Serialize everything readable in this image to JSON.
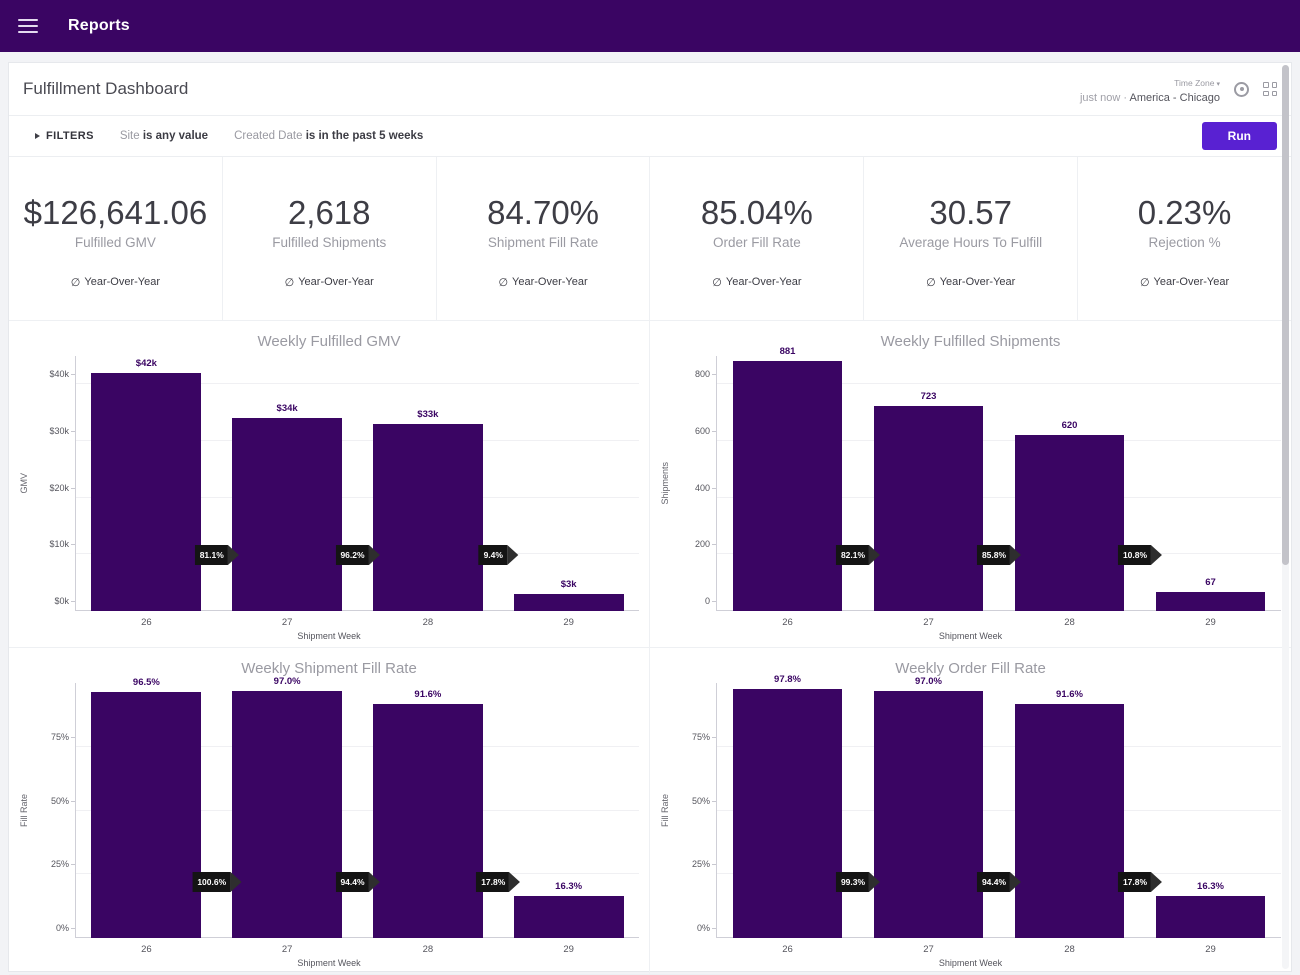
{
  "appbar": {
    "title": "Reports",
    "menu_icon": "hamburger-icon"
  },
  "dashboard": {
    "title": "Fulfillment Dashboard",
    "updated": "just now",
    "separator": "·",
    "timezone_label": "Time Zone",
    "timezone_value": "America - Chicago",
    "gear_icon": "gear-icon",
    "grid_icon": "grid-icon"
  },
  "filters": {
    "toggle_label": "FILTERS",
    "items": [
      {
        "field": "Site",
        "condition": "is any value"
      },
      {
        "field": "Created Date",
        "condition": "is in the past 5 weeks"
      }
    ],
    "run_label": "Run"
  },
  "kpis": [
    {
      "value": "$126,641.06",
      "label": "Fulfilled GMV",
      "delta": "Year-Over-Year",
      "delta_icon": "null-icon"
    },
    {
      "value": "2,618",
      "label": "Fulfilled Shipments",
      "delta": "Year-Over-Year",
      "delta_icon": "null-icon"
    },
    {
      "value": "84.70%",
      "label": "Shipment Fill Rate",
      "delta": "Year-Over-Year",
      "delta_icon": "null-icon"
    },
    {
      "value": "85.04%",
      "label": "Order Fill Rate",
      "delta": "Year-Over-Year",
      "delta_icon": "null-icon"
    },
    {
      "value": "30.57",
      "label": "Average Hours To Fulfill",
      "delta": "Year-Over-Year",
      "delta_icon": "null-icon"
    },
    {
      "value": "0.23%",
      "label": "Rejection %",
      "delta": "Year-Over-Year",
      "delta_icon": "null-icon"
    }
  ],
  "colors": {
    "brand_purple": "#3a0563",
    "run_button": "#5921d2",
    "bar_fill": "#3a0563",
    "delta_pill": "#141414"
  },
  "chart_data": [
    {
      "type": "bar",
      "title": "Weekly Fulfilled GMV",
      "xlabel": "Shipment Week",
      "ylabel": "GMV",
      "categories": [
        "26",
        "27",
        "28",
        "29"
      ],
      "values": [
        42000,
        34000,
        33000,
        3000
      ],
      "value_labels": [
        "$42k",
        "$34k",
        "$33k",
        "$3k"
      ],
      "ylim": [
        0,
        45000
      ],
      "yticks": [
        0,
        10000,
        20000,
        30000,
        40000
      ],
      "ytick_labels": [
        "$0k",
        "$10k",
        "$20k",
        "$30k",
        "$40k"
      ],
      "grid": true,
      "legend": "none",
      "annotations": [
        {
          "label": "81.1%",
          "between": [
            "26",
            "27"
          ]
        },
        {
          "label": "96.2%",
          "between": [
            "27",
            "28"
          ]
        },
        {
          "label": "9.4%",
          "between": [
            "28",
            "29"
          ]
        }
      ]
    },
    {
      "type": "bar",
      "title": "Weekly Fulfilled Shipments",
      "xlabel": "Shipment Week",
      "ylabel": "Shipments",
      "categories": [
        "26",
        "27",
        "28",
        "29"
      ],
      "values": [
        881,
        723,
        620,
        67
      ],
      "value_labels": [
        "881",
        "723",
        "620",
        "67"
      ],
      "ylim": [
        0,
        900
      ],
      "yticks": [
        0,
        200,
        400,
        600,
        800
      ],
      "ytick_labels": [
        "0",
        "200",
        "400",
        "600",
        "800"
      ],
      "grid": true,
      "legend": "none",
      "annotations": [
        {
          "label": "82.1%",
          "between": [
            "26",
            "27"
          ]
        },
        {
          "label": "85.8%",
          "between": [
            "27",
            "28"
          ]
        },
        {
          "label": "10.8%",
          "between": [
            "28",
            "29"
          ]
        }
      ]
    },
    {
      "type": "bar",
      "title": "Weekly Shipment Fill Rate",
      "xlabel": "Shipment Week",
      "ylabel": "Fill Rate",
      "categories": [
        "26",
        "27",
        "28",
        "29"
      ],
      "values": [
        96.5,
        97.0,
        91.6,
        16.3
      ],
      "value_labels": [
        "96.5%",
        "97.0%",
        "91.6%",
        "16.3%"
      ],
      "ylim": [
        0,
        100
      ],
      "yticks": [
        0,
        25,
        50,
        75
      ],
      "ytick_labels": [
        "0%",
        "25%",
        "50%",
        "75%"
      ],
      "grid": true,
      "legend": "none",
      "annotations": [
        {
          "label": "100.6%",
          "between": [
            "26",
            "27"
          ]
        },
        {
          "label": "94.4%",
          "between": [
            "27",
            "28"
          ]
        },
        {
          "label": "17.8%",
          "between": [
            "28",
            "29"
          ]
        }
      ]
    },
    {
      "type": "bar",
      "title": "Weekly Order Fill Rate",
      "xlabel": "Shipment Week",
      "ylabel": "Fill Rate",
      "categories": [
        "26",
        "27",
        "28",
        "29"
      ],
      "values": [
        97.8,
        97.0,
        91.6,
        16.3
      ],
      "value_labels": [
        "97.8%",
        "97.0%",
        "91.6%",
        "16.3%"
      ],
      "ylim": [
        0,
        100
      ],
      "yticks": [
        0,
        25,
        50,
        75
      ],
      "ytick_labels": [
        "0%",
        "25%",
        "50%",
        "75%"
      ],
      "grid": true,
      "legend": "none",
      "annotations": [
        {
          "label": "99.3%",
          "between": [
            "26",
            "27"
          ]
        },
        {
          "label": "94.4%",
          "between": [
            "27",
            "28"
          ]
        },
        {
          "label": "17.8%",
          "between": [
            "28",
            "29"
          ]
        }
      ]
    }
  ]
}
